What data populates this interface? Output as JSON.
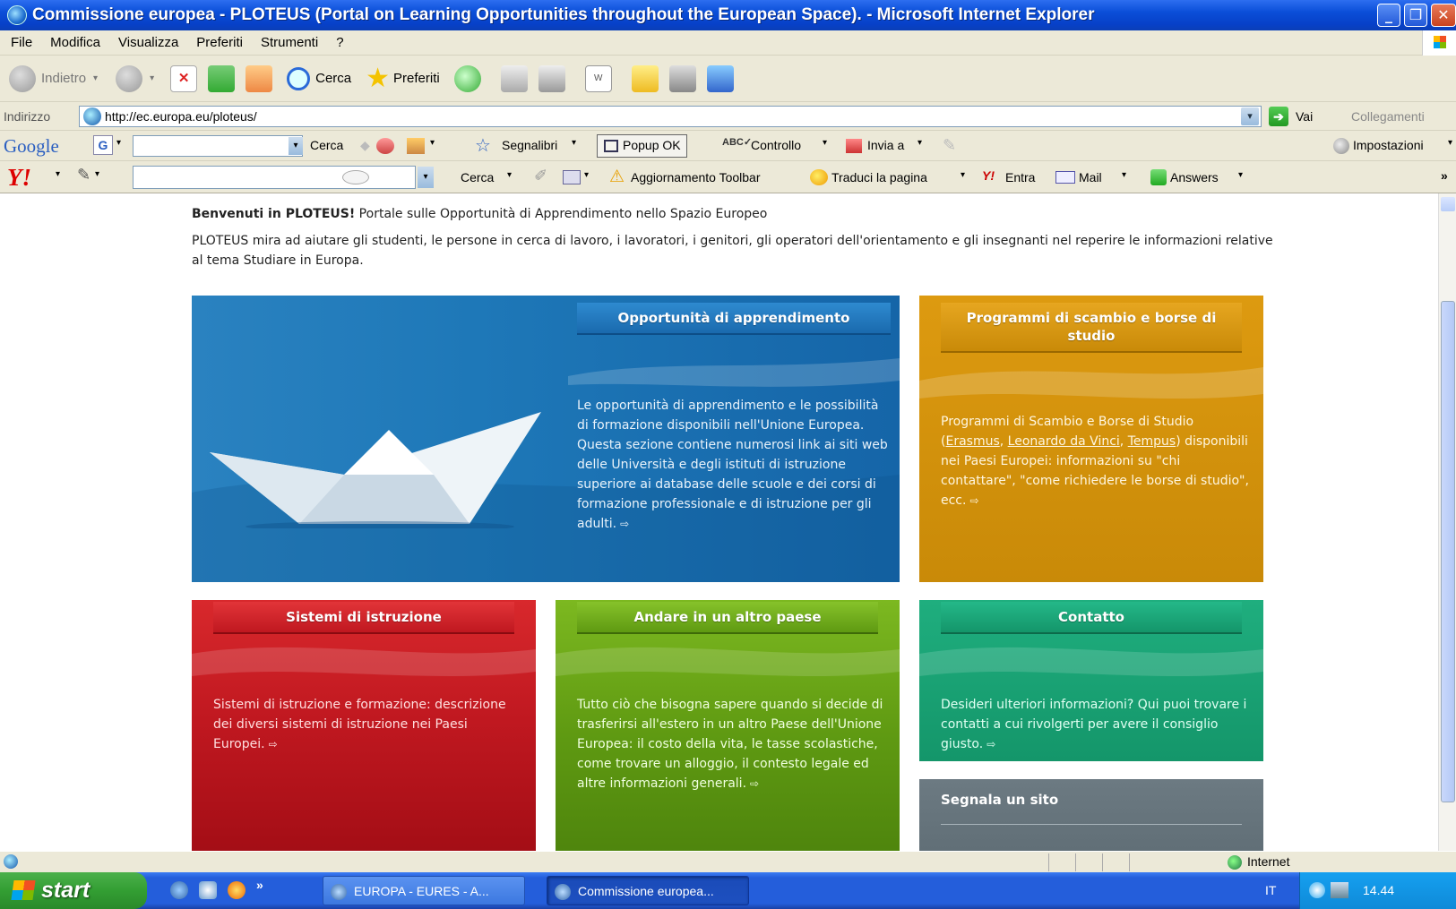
{
  "window": {
    "title": "Commissione europea - PLOTEUS (Portal on Learning Opportunities throughout the European Space). - Microsoft Internet Explorer"
  },
  "menu": [
    "File",
    "Modifica",
    "Visualizza",
    "Preferiti",
    "Strumenti",
    "?"
  ],
  "toolbar": {
    "back": "Indietro",
    "search": "Cerca",
    "favorites": "Preferiti"
  },
  "address": {
    "label": "Indirizzo",
    "url": "http://ec.europa.eu/ploteus/",
    "go": "Vai",
    "links": "Collegamenti"
  },
  "google_bar": {
    "logo": "Google",
    "g": "G",
    "search": "Cerca",
    "bookmarks": "Segnalibri",
    "popup": "Popup OK",
    "spell": "Controllo",
    "send": "Invia a",
    "settings": "Impostazioni"
  },
  "yahoo_bar": {
    "logo": "Y!",
    "search": "Cerca",
    "update": "Aggiornamento Toolbar",
    "translate": "Traduci la pagina",
    "entra": "Entra",
    "mail": "Mail",
    "answers": "Answers"
  },
  "page": {
    "welcome_bold": "Benvenuti in PLOTEUS!",
    "welcome_rest": " Portale sulle Opportunità di Apprendimento nello Spazio Europeo",
    "intro": "PLOTEUS mira ad aiutare gli studenti, le persone in cerca di lavoro, i lavoratori, i genitori, gli operatori dell'orientamento e gli insegnanti nel reperire le informazioni relative al tema Studiare in Europa.",
    "boxes": {
      "learning": {
        "title": "Opportunità di apprendimento",
        "text": "Le opportunità di apprendimento e le possibilità di formazione disponibili nell'Unione Europea. Questa sezione contiene numerosi link ai siti web delle Università e degli istituti di istruzione superiore ai database delle scuole e dei corsi di formazione professionale e di istruzione per gli adulti."
      },
      "exchange": {
        "title": "Programmi di scambio e borse di studio",
        "text_a": "Programmi di Scambio e Borse di Studio (",
        "erasmus": "Erasmus",
        "sep": ", ",
        "leonardo": "Leonardo da Vinci",
        "tempus": "Tempus",
        "text_b": ") disponibili nei Paesi Europei: informazioni su \"chi contattare\", \"come richiedere le borse di studio\", ecc."
      },
      "systems": {
        "title": "Sistemi di istruzione",
        "text": "Sistemi di istruzione e formazione: descrizione dei diversi sistemi di istruzione nei Paesi Europei."
      },
      "moving": {
        "title": "Andare in un altro paese",
        "text": "Tutto ciò che bisogna sapere quando si decide di trasferirsi all'estero in un altro Paese dell'Unione Europea: il costo della vita, le tasse scolastiche, come trovare un alloggio, il contesto legale ed altre informazioni generali."
      },
      "contact": {
        "title": "Contatto",
        "text": "Desideri ulteriori informazioni? Qui puoi trovare i contatti a cui rivolgerti per avere il consiglio giusto."
      },
      "report": {
        "title": "Segnala un sito"
      }
    },
    "arrow": "⇨"
  },
  "status": {
    "zone": "Internet"
  },
  "taskbar": {
    "start": "start",
    "task1": "EUROPA - EURES - A...",
    "task2": "Commissione europea...",
    "lang": "IT",
    "clock": "14.44"
  }
}
